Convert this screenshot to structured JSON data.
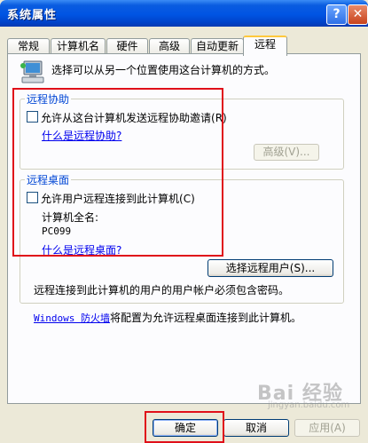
{
  "window": {
    "title": "系统属性",
    "help_glyph": "?",
    "close_glyph": "✕"
  },
  "tabs": [
    "常规",
    "计算机名",
    "硬件",
    "高级",
    "自动更新",
    "远程"
  ],
  "active_tab": "远程",
  "intro": "选择可以从另一个位置使用这台计算机的方式。",
  "remote_assistance": {
    "legend": "远程协助",
    "checkbox_label": "允许从这台计算机发送远程协助邀请",
    "checkbox_key": "(R)",
    "checked": false,
    "link": "什么是远程协助?",
    "advanced_button": "高级(V)..."
  },
  "remote_desktop": {
    "legend": "远程桌面",
    "checkbox_label": "允许用户远程连接到此计算机",
    "checkbox_key": "(C)",
    "checked": false,
    "full_name_label": "计算机全名:",
    "computer_name": "PC099",
    "link": "什么是远程桌面?",
    "select_users_button": "选择远程用户(S)...",
    "password_note": "远程连接到此计算机的用户的用户帐户必须包含密码。",
    "firewall_link": "Windows 防火墙",
    "firewall_text": "将配置为允许远程桌面连接到此计算机。"
  },
  "buttons": {
    "ok": "确定",
    "cancel": "取消",
    "apply": "应用(A)"
  },
  "watermark": {
    "logo": "Bai 经验",
    "url": "jingyan.baidu.com"
  },
  "colors": {
    "title_bar": "#0054e3",
    "highlight_box": "#e0101a",
    "group_legend": "#0046d5"
  }
}
